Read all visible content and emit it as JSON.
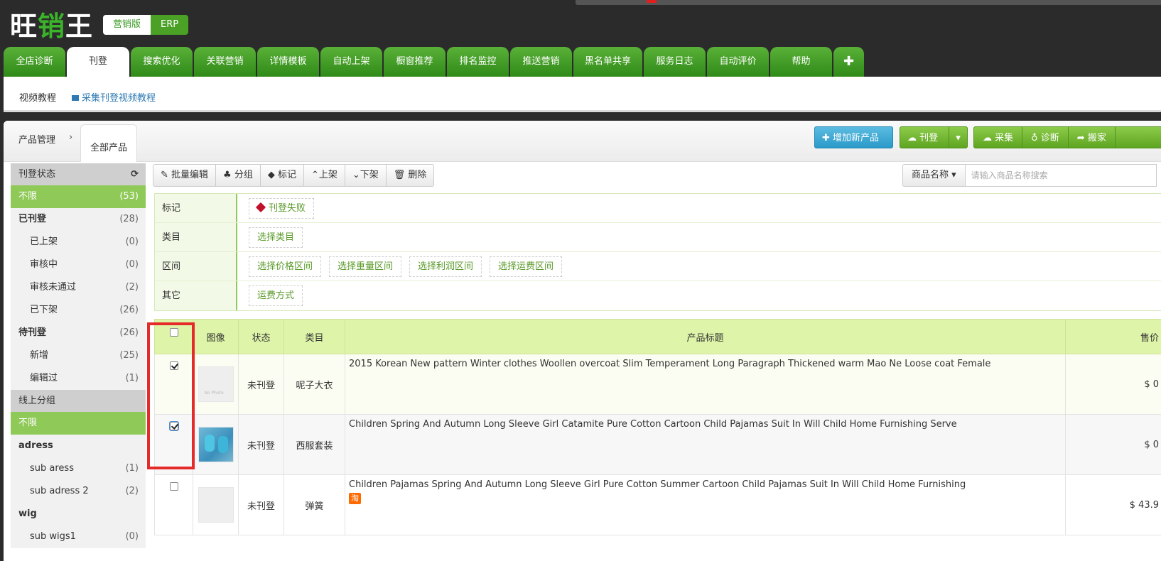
{
  "app": {
    "logo_a": "旺",
    "logo_b": "销",
    "logo_c": "王",
    "edition_marketing": "营销版",
    "edition_erp": "ERP"
  },
  "nav": {
    "tabs": [
      "全店诊断",
      "刊登",
      "搜索优化",
      "关联营销",
      "详情模板",
      "自动上架",
      "橱窗推荐",
      "排名监控",
      "推送营销",
      "黑名单共享",
      "服务日志",
      "自动评价",
      "帮助",
      "✚"
    ],
    "active_index": 1
  },
  "subbar": {
    "video": "视频教程",
    "video_link": "采集刊登视频教程"
  },
  "breadcrumb": {
    "parent": "产品管理",
    "sep": "›",
    "current": "全部产品"
  },
  "header_buttons": {
    "add": "✚ 增加新产品",
    "publish": "☁ 刊登",
    "publish_caret": "▾",
    "collect": "☁ 采集",
    "diagnose": "♁ 诊断",
    "move": "➦ 搬家"
  },
  "sidebar": {
    "status_title": "刊登状态",
    "refresh_icon": "⟳",
    "status_items": [
      {
        "label": "不限",
        "count": "(53)"
      },
      {
        "label": "已刊登",
        "count": "(28)"
      },
      {
        "label": "已上架",
        "count": "(0)"
      },
      {
        "label": "审核中",
        "count": "(0)"
      },
      {
        "label": "审核未通过",
        "count": "(2)"
      },
      {
        "label": "已下架",
        "count": "(26)"
      },
      {
        "label": "待刊登",
        "count": "(26)"
      },
      {
        "label": "新增",
        "count": "(25)"
      },
      {
        "label": "编辑过",
        "count": "(1)"
      }
    ],
    "group_title": "线上分组",
    "group_items": [
      {
        "label": "不限",
        "count": ""
      },
      {
        "label": "adress",
        "count": ""
      },
      {
        "label": "sub aress",
        "count": "(1)"
      },
      {
        "label": "sub adress 2",
        "count": "(2)"
      },
      {
        "label": "wig",
        "count": ""
      },
      {
        "label": "sub wigs1",
        "count": "(0)"
      }
    ]
  },
  "toolbar": {
    "batch_edit": "✎ 批量编辑",
    "group": "♣ 分组",
    "mark": "◆ 标记",
    "up": "⌃上架",
    "down": "⌄下架",
    "delete": "🗑 删除"
  },
  "search": {
    "field": "商品名称 ▾",
    "placeholder": "请输入商品名称搜索"
  },
  "filters": {
    "mark_label": "标记",
    "mark_opt": "刊登失败",
    "cat_label": "类目",
    "cat_opt": "选择类目",
    "range_label": "区间",
    "range_opts": [
      "选择价格区间",
      "选择重量区间",
      "选择利润区间",
      "选择运费区间"
    ],
    "other_label": "其它",
    "other_opt": "运费方式"
  },
  "table": {
    "headers": {
      "image": "图像",
      "status": "状态",
      "category": "类目",
      "title": "产品标题",
      "price": "售价"
    },
    "rows": [
      {
        "checked": true,
        "status": "未刊登",
        "category": "呢子大衣",
        "title": "2015 Korean New pattern Winter clothes Woollen overcoat Slim Temperament Long Paragraph Thickened warm Mao Ne Loose coat Female",
        "price": "$ 0"
      },
      {
        "checked": true,
        "status": "未刊登",
        "category": "西服套装",
        "title": "Children Spring And Autumn Long Sleeve Girl Catamite Pure Cotton Cartoon Child Pajamas Suit In Will Child Home Furnishing Serve",
        "price": "$ 0"
      },
      {
        "checked": false,
        "status": "未刊登",
        "category": "弹簧",
        "title": "Children Pajamas Spring And Autumn Long Sleeve Girl Pure Cotton Summer Cartoon Child Pajamas Suit In Will Child Home Furnishing",
        "price": "$ 43.9",
        "badge": "淘"
      }
    ],
    "no_photo": "No Photo"
  },
  "colors": {
    "brand_green": "#3bb32b",
    "accent_blue": "#2a9ac9",
    "highlight_red": "#e52a2a"
  }
}
